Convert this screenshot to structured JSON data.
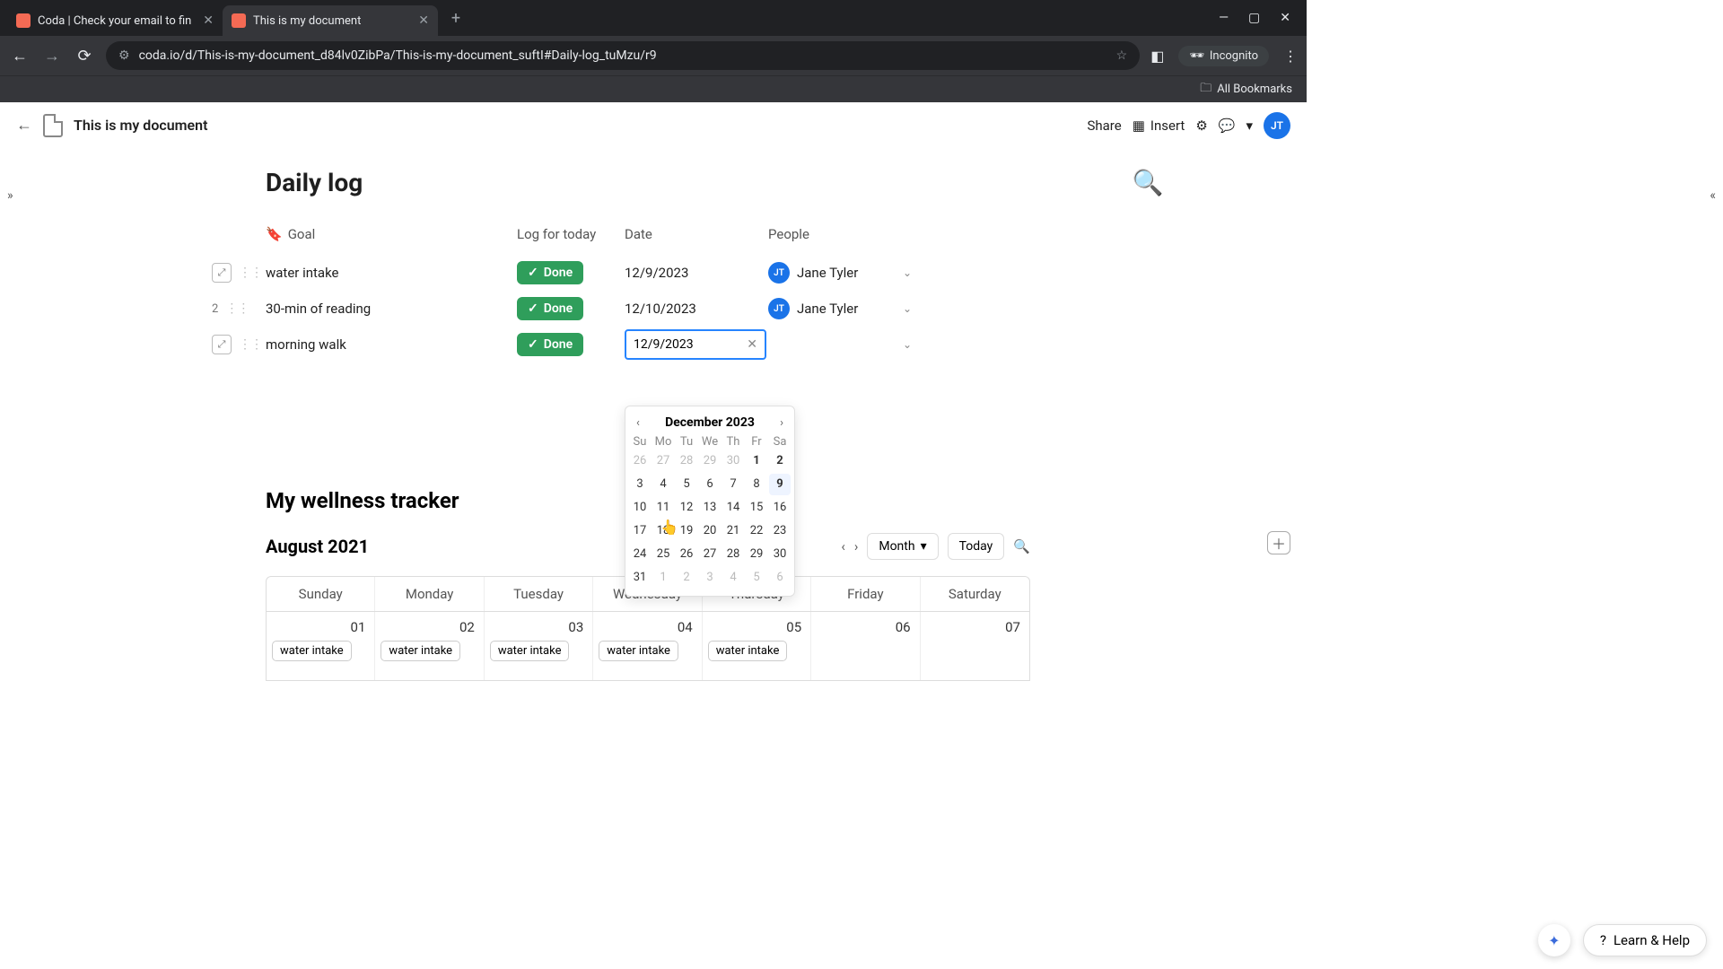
{
  "browser": {
    "tabs": [
      {
        "title": "Coda | Check your email to fin",
        "active": false
      },
      {
        "title": "This is my document",
        "active": true
      }
    ],
    "url": "coda.io/d/This-is-my-document_d84lv0ZibPa/This-is-my-document_suftI#Daily-log_tuMzu/r9",
    "incognito_label": "Incognito",
    "all_bookmarks": "All Bookmarks"
  },
  "header": {
    "doc_title": "This is my document",
    "share": "Share",
    "insert": "Insert",
    "avatar_initials": "JT"
  },
  "daily_log": {
    "title": "Daily log",
    "columns": {
      "goal": "Goal",
      "log": "Log for today",
      "date": "Date",
      "people": "People"
    },
    "done_label": "Done",
    "rows": [
      {
        "num": null,
        "goal": "water intake",
        "date": "12/9/2023",
        "person": "Jane Tyler",
        "person_initials": "JT",
        "expand": true,
        "editing": false
      },
      {
        "num": "2",
        "goal": "30-min of reading",
        "date": "12/10/2023",
        "person": "Jane Tyler",
        "person_initials": "JT",
        "expand": false,
        "editing": false
      },
      {
        "num": null,
        "goal": "morning walk",
        "date": "12/9/2023",
        "person": "",
        "person_initials": "",
        "expand": true,
        "editing": true
      }
    ]
  },
  "datepicker": {
    "month_label": "December 2023",
    "dow": [
      "Su",
      "Mo",
      "Tu",
      "We",
      "Th",
      "Fr",
      "Sa"
    ],
    "weeks": [
      [
        {
          "d": "26",
          "m": true
        },
        {
          "d": "27",
          "m": true
        },
        {
          "d": "28",
          "m": true
        },
        {
          "d": "29",
          "m": true
        },
        {
          "d": "30",
          "m": true
        },
        {
          "d": "1",
          "b": true
        },
        {
          "d": "2",
          "b": true
        }
      ],
      [
        {
          "d": "3"
        },
        {
          "d": "4"
        },
        {
          "d": "5"
        },
        {
          "d": "6"
        },
        {
          "d": "7"
        },
        {
          "d": "8"
        },
        {
          "d": "9",
          "sel": true
        }
      ],
      [
        {
          "d": "10"
        },
        {
          "d": "11"
        },
        {
          "d": "12"
        },
        {
          "d": "13"
        },
        {
          "d": "14"
        },
        {
          "d": "15"
        },
        {
          "d": "16"
        }
      ],
      [
        {
          "d": "17"
        },
        {
          "d": "18"
        },
        {
          "d": "19"
        },
        {
          "d": "20"
        },
        {
          "d": "21"
        },
        {
          "d": "22"
        },
        {
          "d": "23"
        }
      ],
      [
        {
          "d": "24"
        },
        {
          "d": "25"
        },
        {
          "d": "26"
        },
        {
          "d": "27"
        },
        {
          "d": "28"
        },
        {
          "d": "29"
        },
        {
          "d": "30"
        }
      ],
      [
        {
          "d": "31"
        },
        {
          "d": "1",
          "m": true
        },
        {
          "d": "2",
          "m": true
        },
        {
          "d": "3",
          "m": true
        },
        {
          "d": "4",
          "m": true
        },
        {
          "d": "5",
          "m": true
        },
        {
          "d": "6",
          "m": true
        }
      ]
    ]
  },
  "wellness": {
    "title": "My wellness tracker",
    "month": "August 2021",
    "view_label": "Month",
    "today_label": "Today",
    "dow": [
      "Sunday",
      "Monday",
      "Tuesday",
      "Wednesday",
      "Thursday",
      "Friday",
      "Saturday"
    ],
    "dates": [
      "01",
      "02",
      "03",
      "04",
      "05",
      "06",
      "07"
    ],
    "chip": "water intake"
  },
  "footer": {
    "learn_help": "Learn & Help"
  }
}
